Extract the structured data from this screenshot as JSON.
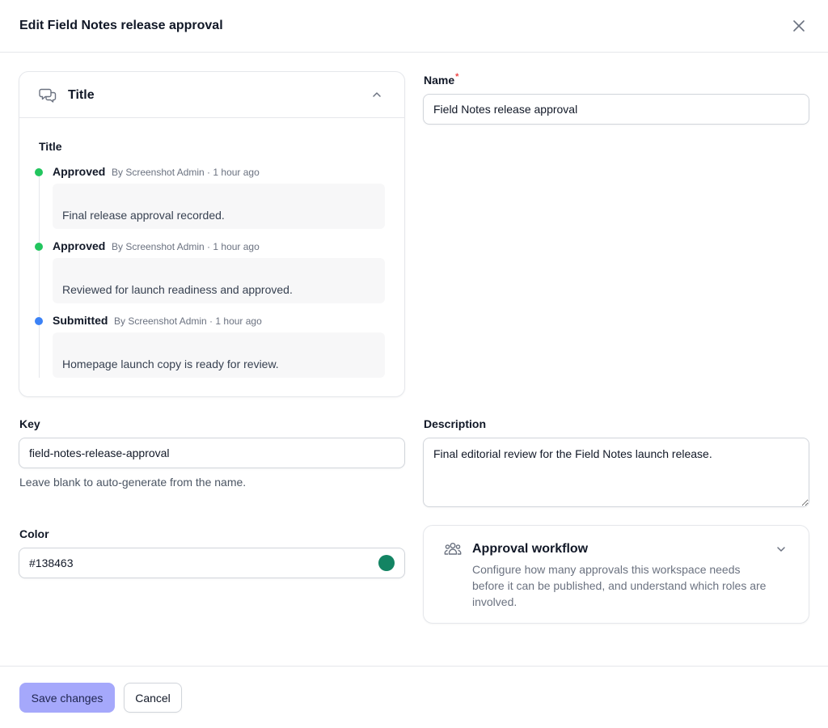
{
  "dialog": {
    "title": "Edit Field Notes release approval",
    "close_icon": "close-icon"
  },
  "activity": {
    "header_title": "Title",
    "header_icon": "chat-bubbles-icon",
    "collapse_icon": "chevron-up-icon",
    "timeline_title": "Title",
    "items": [
      {
        "status": "Approved",
        "meta": "By Screenshot Admin · 1 hour ago",
        "comment": "Final release approval recorded.",
        "dot_color": "#22c55e"
      },
      {
        "status": "Approved",
        "meta": "By Screenshot Admin · 1 hour ago",
        "comment": "Reviewed for launch readiness and approved.",
        "dot_color": "#22c55e"
      },
      {
        "status": "Submitted",
        "meta": "By Screenshot Admin · 1 hour ago",
        "comment": "Homepage launch copy is ready for review.",
        "dot_color": "#3b82f6"
      }
    ]
  },
  "form": {
    "name": {
      "label": "Name",
      "required_mark": "*",
      "value": "Field Notes release approval"
    },
    "key": {
      "label": "Key",
      "value": "field-notes-release-approval",
      "help": "Leave blank to auto-generate from the name."
    },
    "description": {
      "label": "Description",
      "value": "Final editorial review for the Field Notes launch release."
    },
    "color": {
      "label": "Color",
      "value": "#138463",
      "swatch_color": "#138463"
    }
  },
  "workflow": {
    "icon": "users-icon",
    "title": "Approval workflow",
    "description": "Configure how many approvals this workspace needs before it can be published, and understand which roles are involved.",
    "expand_icon": "chevron-down-icon"
  },
  "footer": {
    "save_label": "Save changes",
    "cancel_label": "Cancel"
  },
  "colors": {
    "primary_button": "#a5a8fb",
    "approved": "#22c55e",
    "submitted": "#3b82f6",
    "required": "#ef4444"
  }
}
